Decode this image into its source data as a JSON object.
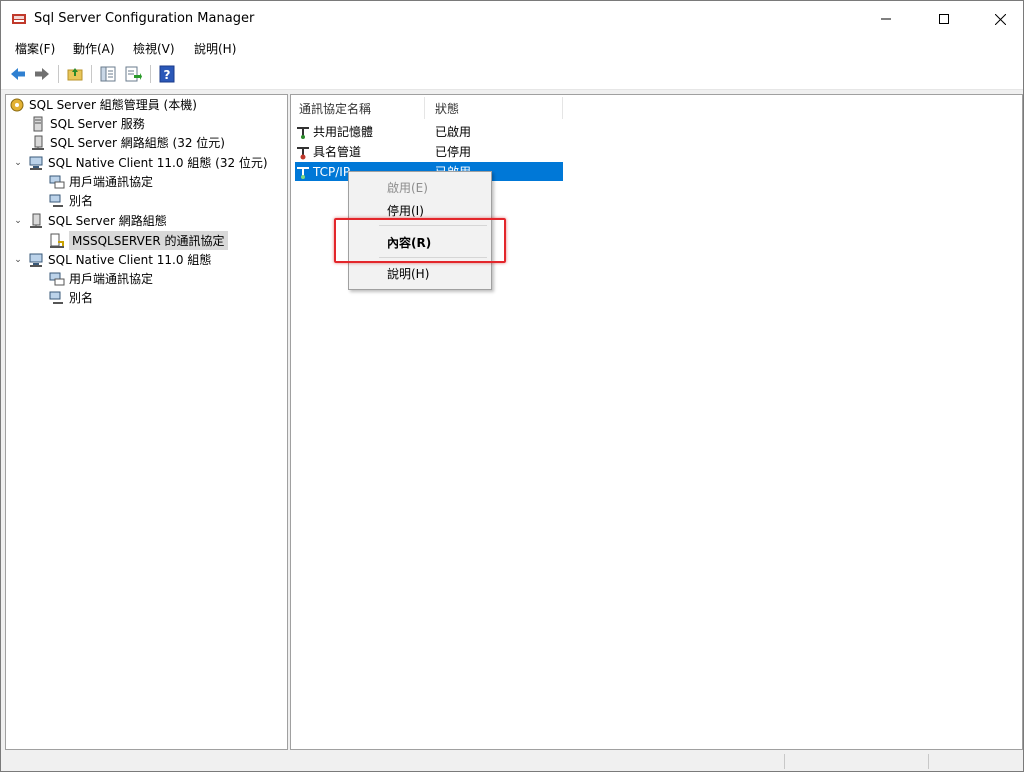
{
  "window": {
    "title": "Sql Server Configuration Manager"
  },
  "menu": [
    "檔案(F)",
    "動作(A)",
    "檢視(V)",
    "說明(H)"
  ],
  "toolbar": [
    "back-icon",
    "forward-icon",
    "up-folder-icon",
    "show-hide-console-icon",
    "export-list-icon",
    "help-icon"
  ],
  "tree": [
    {
      "label": "SQL Server 組態管理員 (本機)",
      "icon": "config-manager-icon",
      "expandable": false,
      "level": 0
    },
    {
      "label": "SQL Server 服務",
      "icon": "services-icon",
      "expandable": false,
      "level": 1
    },
    {
      "label": "SQL Server 網路組態 (32 位元)",
      "icon": "network-config-icon",
      "expandable": false,
      "level": 1
    },
    {
      "label": "SQL Native Client 11.0 組態 (32 位元)",
      "icon": "native-client-icon",
      "expandable": true,
      "level": 1
    },
    {
      "label": "用戶端通訊協定",
      "icon": "client-protocols-icon",
      "expandable": false,
      "level": 2
    },
    {
      "label": "別名",
      "icon": "aliases-icon",
      "expandable": false,
      "level": 2
    },
    {
      "label": "SQL Server 網路組態",
      "icon": "network-config-icon",
      "expandable": true,
      "level": 1
    },
    {
      "label": "MSSQLSERVER 的通訊協定",
      "icon": "protocols-icon",
      "expandable": false,
      "level": 2,
      "selected": true
    },
    {
      "label": "SQL Native Client 11.0 組態",
      "icon": "native-client-icon",
      "expandable": true,
      "level": 1
    },
    {
      "label": "用戶端通訊協定",
      "icon": "client-protocols-icon",
      "expandable": false,
      "level": 2
    },
    {
      "label": "別名",
      "icon": "aliases-icon",
      "expandable": false,
      "level": 2
    }
  ],
  "list": {
    "columns": [
      "通訊協定名稱",
      "狀態"
    ],
    "rows": [
      {
        "name": "共用記憶體",
        "status": "已啟用"
      },
      {
        "name": "具名管道",
        "status": "已停用"
      },
      {
        "name": "TCP/IP",
        "status": "已啟用",
        "selected": true
      }
    ]
  },
  "context_menu": {
    "items": [
      {
        "label": "啟用(E)",
        "disabled": true
      },
      {
        "label": "停用(I)"
      },
      {
        "label": "內容(R)",
        "bold": true
      },
      {
        "label": "說明(H)"
      }
    ]
  },
  "colors": {
    "selection": "#0078d7",
    "highlight_box": "#e3262b"
  }
}
